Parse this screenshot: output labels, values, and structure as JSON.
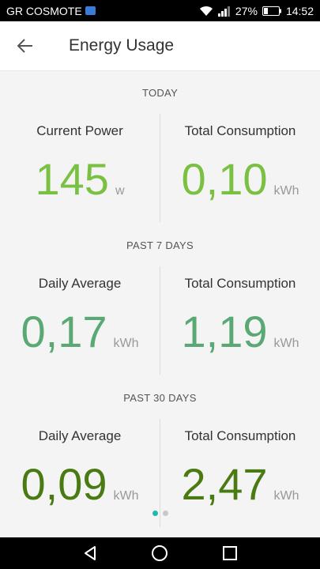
{
  "status_bar": {
    "carrier": "GR COSMOTE",
    "battery": "27%",
    "time": "14:52"
  },
  "app_bar": {
    "title": "Energy Usage",
    "back_icon": "arrow-back-icon"
  },
  "sections": [
    {
      "header": "TODAY",
      "left": {
        "label": "Current Power",
        "value": "145",
        "unit": "w"
      },
      "right": {
        "label": "Total Consumption",
        "value": "0,10",
        "unit": "kWh"
      },
      "color": "#7ac143"
    },
    {
      "header": "PAST 7 DAYS",
      "left": {
        "label": "Daily Average",
        "value": "0,17",
        "unit": "kWh"
      },
      "right": {
        "label": "Total Consumption",
        "value": "1,19",
        "unit": "kWh"
      },
      "color": "#5aa873"
    },
    {
      "header": "PAST 30 DAYS",
      "left": {
        "label": "Daily Average",
        "value": "0,09",
        "unit": "kWh"
      },
      "right": {
        "label": "Total Consumption",
        "value": "2,47",
        "unit": "kWh"
      },
      "color": "#4a7a12"
    }
  ],
  "page_indicator": {
    "count": 2,
    "active": 1
  },
  "nav_bar": {
    "icons": [
      "back-triangle-icon",
      "home-circle-icon",
      "recents-square-icon"
    ]
  }
}
